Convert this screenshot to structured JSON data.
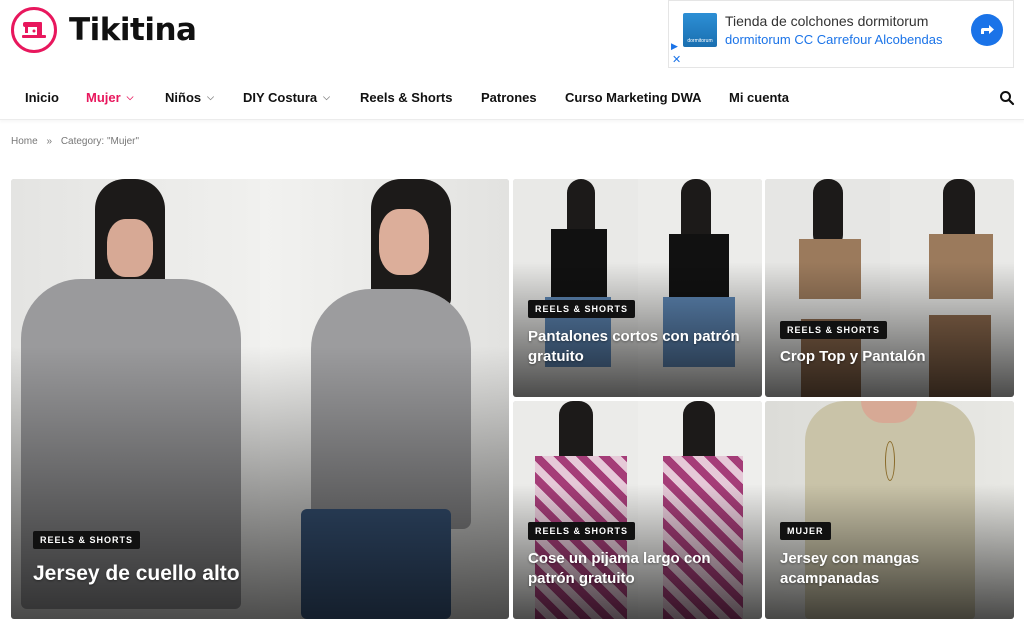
{
  "site": {
    "name": "Tikitina",
    "brand_color": "#e8175d",
    "logo_icon": "sewing-machine-icon"
  },
  "ad": {
    "title": "Tienda de colchones dormitorum",
    "subtitle": "dormitorum CC Carrefour Alcobendas",
    "thumb_text": "dormitorum",
    "icons": [
      "ad-choices-play-icon",
      "ad-close-icon",
      "directions-arrow-icon"
    ]
  },
  "nav": {
    "items": [
      {
        "label": "Inicio",
        "dropdown": false,
        "active": false
      },
      {
        "label": "Mujer",
        "dropdown": true,
        "active": true
      },
      {
        "label": "Niños",
        "dropdown": true,
        "active": false
      },
      {
        "label": "DIY Costura",
        "dropdown": true,
        "active": false
      },
      {
        "label": "Reels & Shorts",
        "dropdown": false,
        "active": false
      },
      {
        "label": "Patrones",
        "dropdown": false,
        "active": false
      },
      {
        "label": "Curso Marketing DWA",
        "dropdown": false,
        "active": false
      },
      {
        "label": "Mi cuenta",
        "dropdown": false,
        "active": false
      }
    ],
    "search_icon": "search-icon"
  },
  "breadcrumb": {
    "home": "Home",
    "separator": "»",
    "current": "Category: \"Mujer\""
  },
  "posts": [
    {
      "tag": "REELS & SHORTS",
      "title": "Jersey de cuello alto"
    },
    {
      "tag": "REELS & SHORTS",
      "title": "Pantalones cortos con patrón gratuito"
    },
    {
      "tag": "REELS & SHORTS",
      "title": "Crop Top y Pantalón"
    },
    {
      "tag": "REELS & SHORTS",
      "title": "Cose un pijama largo con patrón gratuito"
    },
    {
      "tag": "MUJER",
      "title": "Jersey con mangas acampanadas"
    }
  ]
}
